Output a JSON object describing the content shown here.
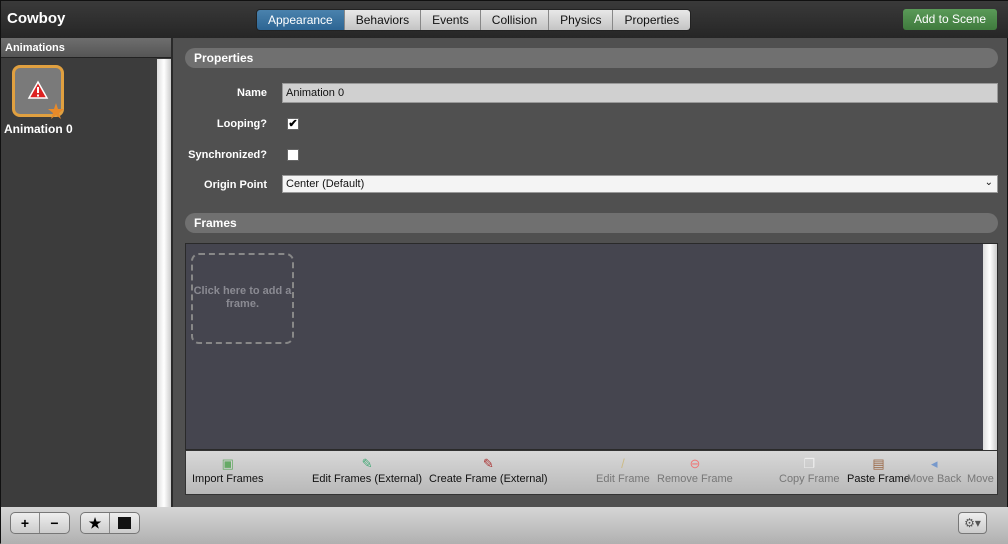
{
  "window": {
    "title": "Cowboy"
  },
  "tabs": [
    {
      "label": "Appearance",
      "active": true
    },
    {
      "label": "Behaviors"
    },
    {
      "label": "Events"
    },
    {
      "label": "Collision"
    },
    {
      "label": "Physics"
    },
    {
      "label": "Properties"
    }
  ],
  "add_to_scene": "Add to Scene",
  "sidebar": {
    "header": "Animations",
    "items": [
      {
        "label": "Animation 0",
        "icon": "warning-icon",
        "badge": "star-icon"
      }
    ]
  },
  "properties": {
    "header": "Properties",
    "name_label": "Name",
    "name_value": "Animation 0",
    "looping_label": "Looping?",
    "looping_checked": true,
    "looping_mark": "✔",
    "synchronized_label": "Synchronized?",
    "synchronized_checked": false,
    "origin_label": "Origin Point",
    "origin_value": "Center (Default)"
  },
  "frames": {
    "header": "Frames",
    "add_prompt": "Click here to add a frame."
  },
  "toolbar": [
    {
      "label": "Import Frames",
      "icon": "import-icon",
      "enabled": true
    },
    {
      "label": "Edit Frames (External)",
      "icon": "paintbrush-icon",
      "enabled": true
    },
    {
      "label": "Create Frame (External)",
      "icon": "brush-add-icon",
      "enabled": true
    },
    {
      "label": "Edit Frame",
      "icon": "pencil-icon",
      "enabled": false
    },
    {
      "label": "Remove Frame",
      "icon": "remove-icon",
      "enabled": false
    },
    {
      "label": "Copy Frame",
      "icon": "copy-icon",
      "enabled": false
    },
    {
      "label": "Paste Frame",
      "icon": "paste-icon",
      "enabled": true
    },
    {
      "label": "Move Back",
      "icon": "arrow-left-icon",
      "enabled": false
    },
    {
      "label": "Move",
      "icon": "arrow-right-icon",
      "enabled": false
    }
  ],
  "bottom": {
    "add": "+",
    "remove": "−",
    "favorite": "★",
    "gear": "⚙▾"
  },
  "colors": {
    "accent": "#2d6593",
    "add_scene": "#3f7a3d",
    "selection": "#e0a040"
  }
}
